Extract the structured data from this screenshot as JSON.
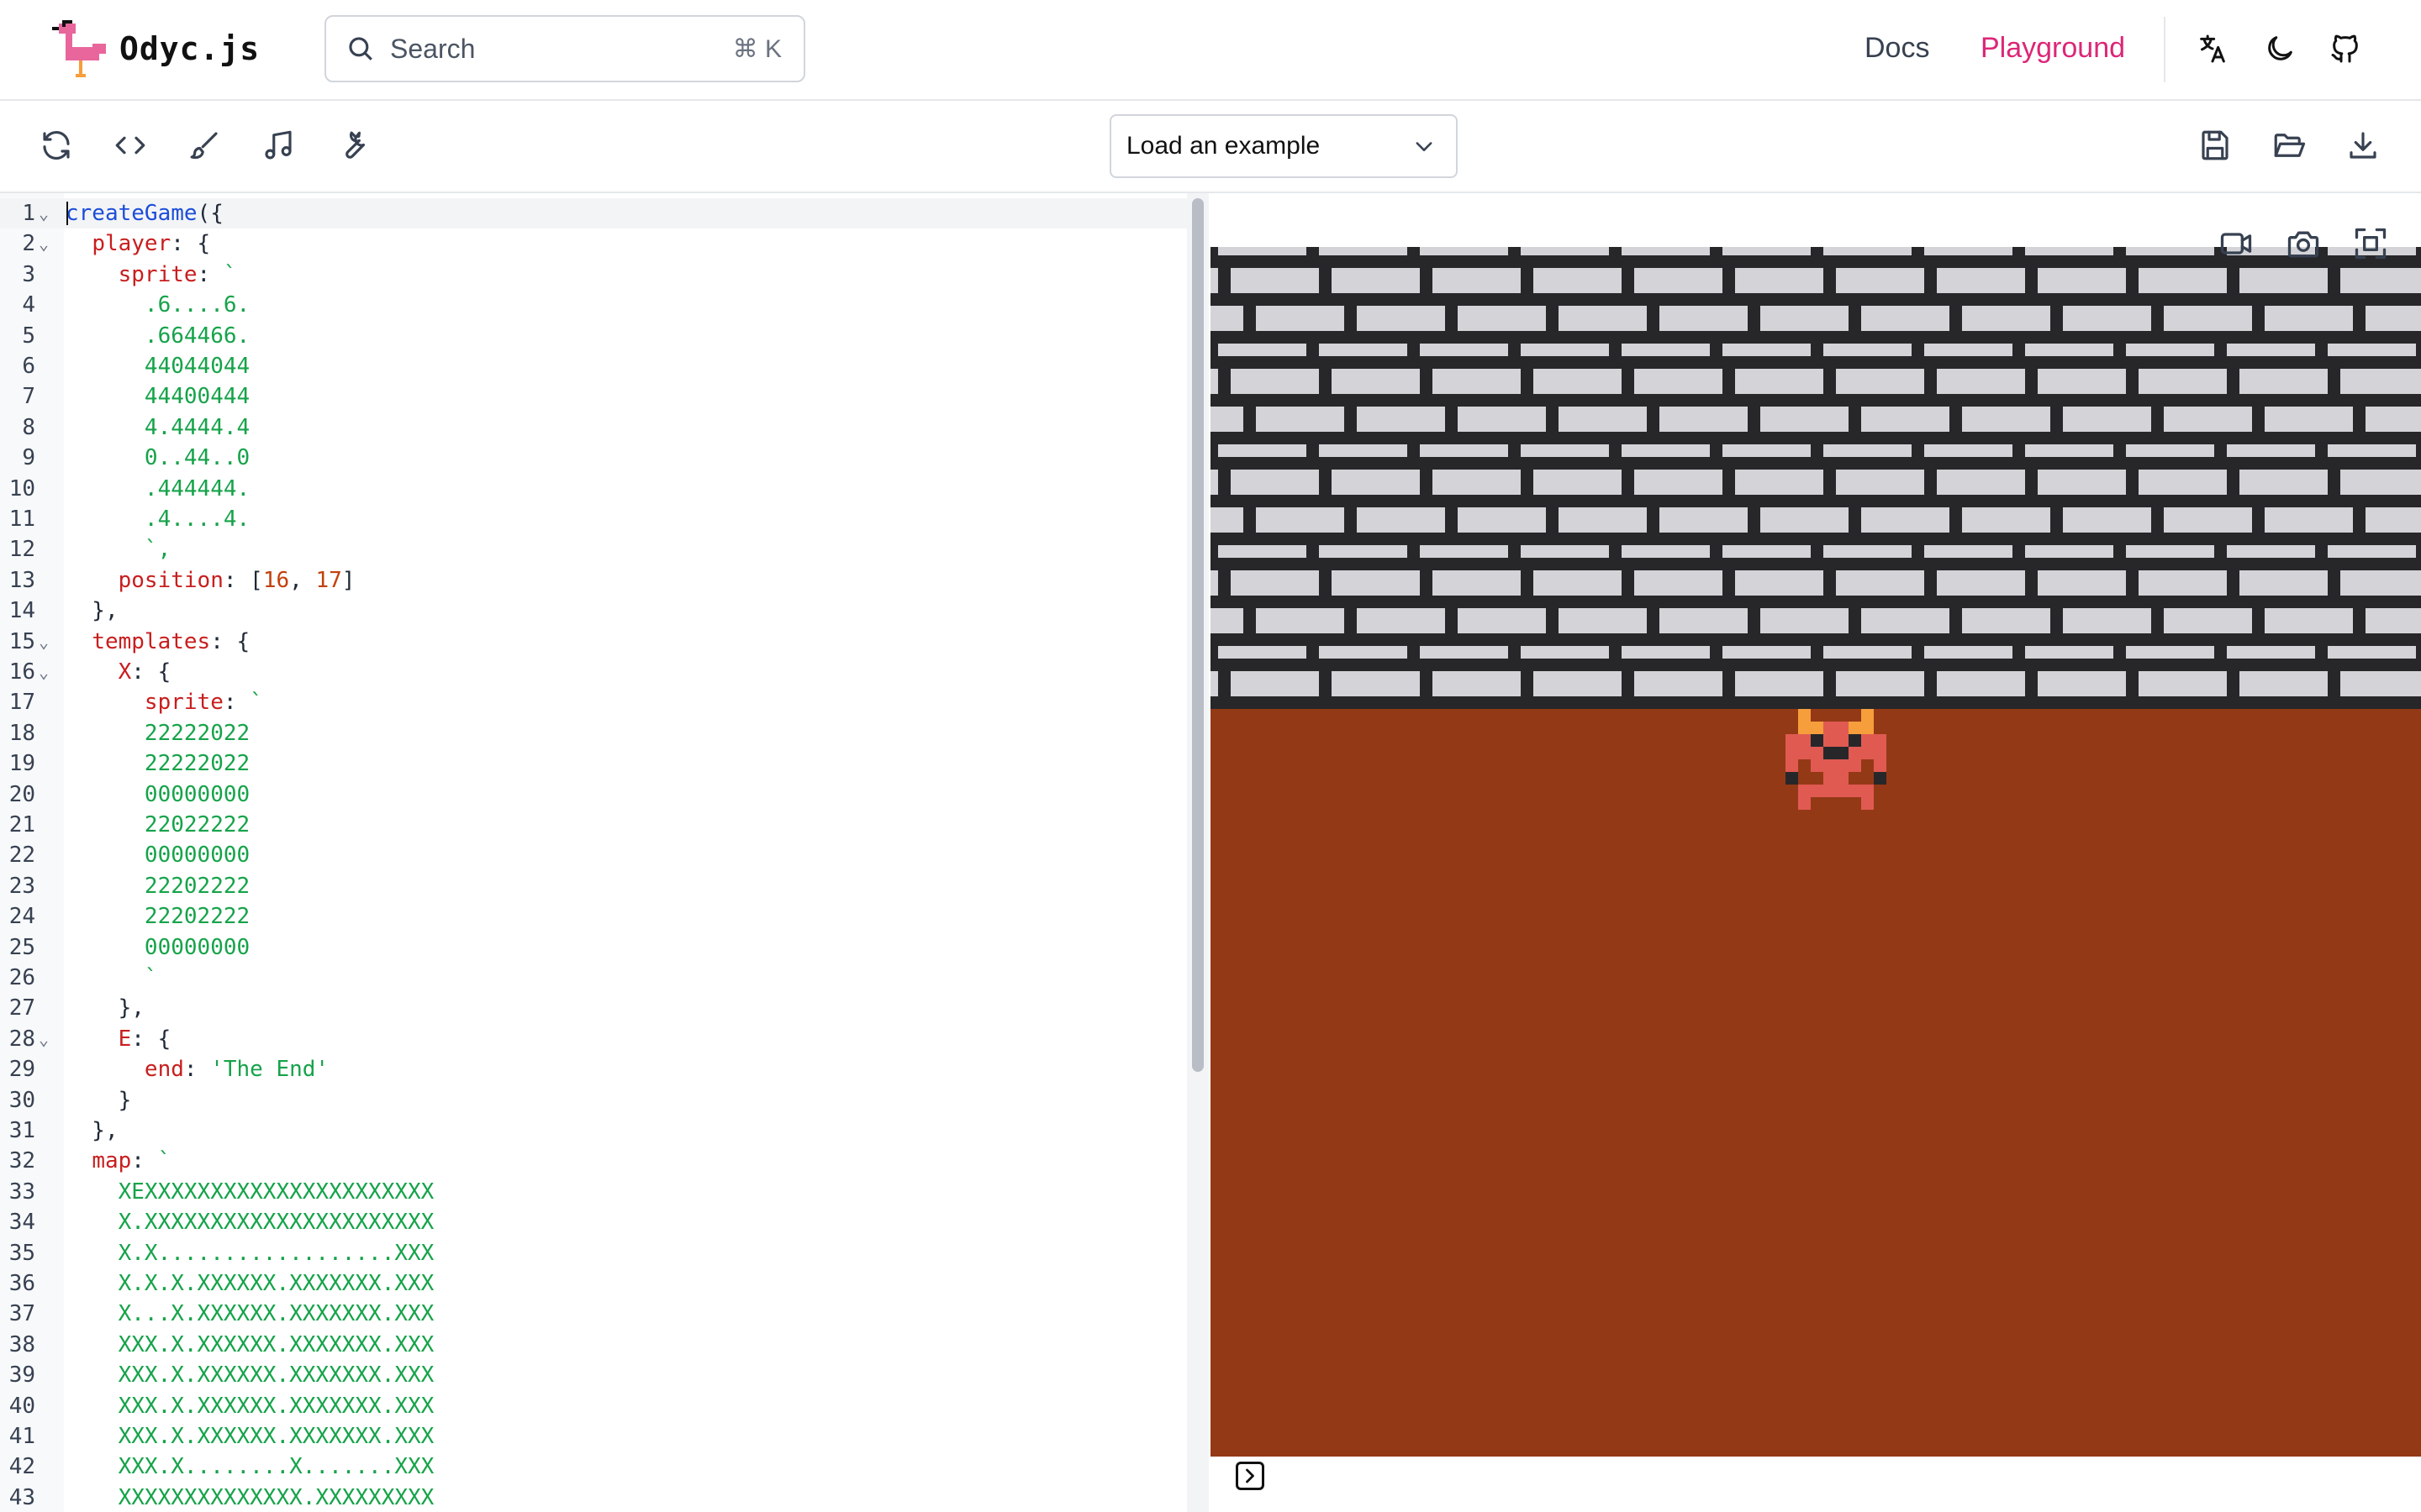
{
  "app": {
    "name": "Odyc.js"
  },
  "search": {
    "placeholder": "Search",
    "shortcut": "⌘ K"
  },
  "nav": {
    "docs": "Docs",
    "playground": "Playground"
  },
  "nav_icons": [
    "translate-icon",
    "moon-icon",
    "github-icon"
  ],
  "toolbar": {
    "left_icons": [
      "refresh-icon",
      "code-icon",
      "brush-icon",
      "music-note-icon",
      "wrench-icon"
    ],
    "example_select": {
      "selected": "Load an example"
    },
    "right_icons": [
      "save-icon",
      "folder-open-icon",
      "download-icon"
    ]
  },
  "editor": {
    "lines": [
      {
        "n": "1",
        "text": "createGame({",
        "fold": true
      },
      {
        "n": "2",
        "text": "  player: {",
        "fold": true
      },
      {
        "n": "3",
        "text": "    sprite: `"
      },
      {
        "n": "4",
        "text": "      .6....6."
      },
      {
        "n": "5",
        "text": "      .664466."
      },
      {
        "n": "6",
        "text": "      44044044"
      },
      {
        "n": "7",
        "text": "      44400444"
      },
      {
        "n": "8",
        "text": "      4.4444.4"
      },
      {
        "n": "9",
        "text": "      0..44..0"
      },
      {
        "n": "10",
        "text": "      .444444."
      },
      {
        "n": "11",
        "text": "      .4....4."
      },
      {
        "n": "12",
        "text": "      `,"
      },
      {
        "n": "13",
        "text": "    position: [16, 17]"
      },
      {
        "n": "14",
        "text": "  },"
      },
      {
        "n": "15",
        "text": "  templates: {",
        "fold": true
      },
      {
        "n": "16",
        "text": "    X: {",
        "fold": true
      },
      {
        "n": "17",
        "text": "      sprite: `"
      },
      {
        "n": "18",
        "text": "      22222022"
      },
      {
        "n": "19",
        "text": "      22222022"
      },
      {
        "n": "20",
        "text": "      00000000"
      },
      {
        "n": "21",
        "text": "      22022222"
      },
      {
        "n": "22",
        "text": "      00000000"
      },
      {
        "n": "23",
        "text": "      22202222"
      },
      {
        "n": "24",
        "text": "      22202222"
      },
      {
        "n": "25",
        "text": "      00000000"
      },
      {
        "n": "26",
        "text": "      `"
      },
      {
        "n": "27",
        "text": "    },"
      },
      {
        "n": "28",
        "text": "    E: {",
        "fold": true
      },
      {
        "n": "29",
        "text": "      end: 'The End'"
      },
      {
        "n": "30",
        "text": "    }"
      },
      {
        "n": "31",
        "text": "  },"
      },
      {
        "n": "32",
        "text": "  map: `"
      },
      {
        "n": "33",
        "text": "    XEXXXXXXXXXXXXXXXXXXXXXX"
      },
      {
        "n": "34",
        "text": "    X.XXXXXXXXXXXXXXXXXXXXXX"
      },
      {
        "n": "35",
        "text": "    X.X..................XXX"
      },
      {
        "n": "36",
        "text": "    X.X.X.XXXXXX.XXXXXXX.XXX"
      },
      {
        "n": "37",
        "text": "    X...X.XXXXXX.XXXXXXX.XXX"
      },
      {
        "n": "38",
        "text": "    XXX.X.XXXXXX.XXXXXXX.XXX"
      },
      {
        "n": "39",
        "text": "    XXX.X.XXXXXX.XXXXXXX.XXX"
      },
      {
        "n": "40",
        "text": "    XXX.X.XXXXXX.XXXXXXX.XXX"
      },
      {
        "n": "41",
        "text": "    XXX.X.XXXXXX.XXXXXXX.XXX"
      },
      {
        "n": "42",
        "text": "    XXX.X........X.......XXX"
      },
      {
        "n": "43",
        "text": "    XXXXXXXXXXXXXX.XXXXXXXXX"
      }
    ]
  },
  "game": {
    "overlay_icons": [
      "video-camera-icon",
      "camera-icon",
      "fullscreen-icon"
    ],
    "colors": {
      "wall": "#27272a",
      "brick": "#d4d4d8",
      "floor": "#943916",
      "player": "#e05a52",
      "player_accent": "#f59e3b"
    }
  },
  "colors": {
    "accent": "#db2777",
    "keyword_fn": "#1d4ed8",
    "property": "#c81e1e",
    "string": "#16a34a",
    "number": "#c2410c"
  }
}
